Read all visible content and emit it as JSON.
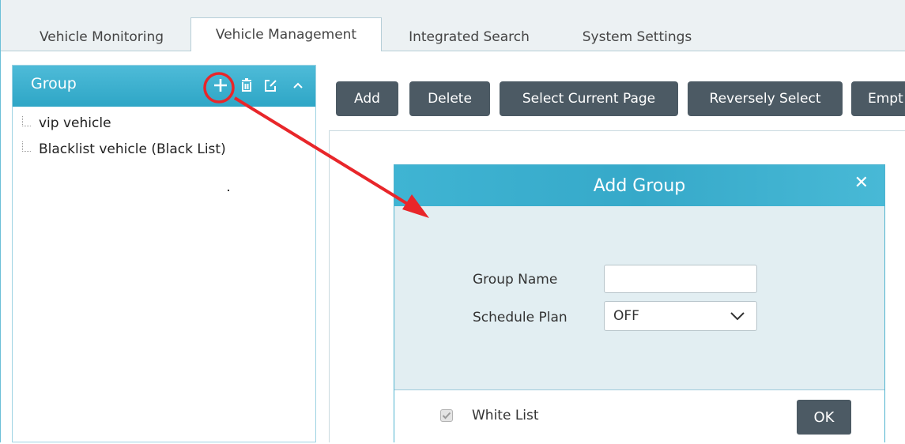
{
  "tabs": [
    {
      "label": "Vehicle Monitoring"
    },
    {
      "label": "Vehicle Management"
    },
    {
      "label": "Integrated Search"
    },
    {
      "label": "System Settings"
    }
  ],
  "group_panel": {
    "title": "Group",
    "icons": [
      "add-icon",
      "delete-icon",
      "edit-icon",
      "collapse-icon"
    ],
    "items": [
      {
        "label": "vip vehicle"
      },
      {
        "label": "Blacklist vehicle (Black List)"
      }
    ]
  },
  "toolbar": {
    "add_label": "Add",
    "delete_label": "Delete",
    "select_page_label": "Select Current Page",
    "reverse_select_label": "Reversely Select",
    "empty_label": "Empt"
  },
  "dialog": {
    "title": "Add Group",
    "close_glyph": "✕",
    "group_name_label": "Group Name",
    "group_name_value": "",
    "schedule_label": "Schedule Plan",
    "schedule_value": "OFF",
    "white_list_label": "White List",
    "white_list_checked": true,
    "ok_label": "OK"
  },
  "colors": {
    "header_blue": "#2ea6c6",
    "button_dark": "#4c5a64",
    "annotation_red": "#e8262a"
  }
}
